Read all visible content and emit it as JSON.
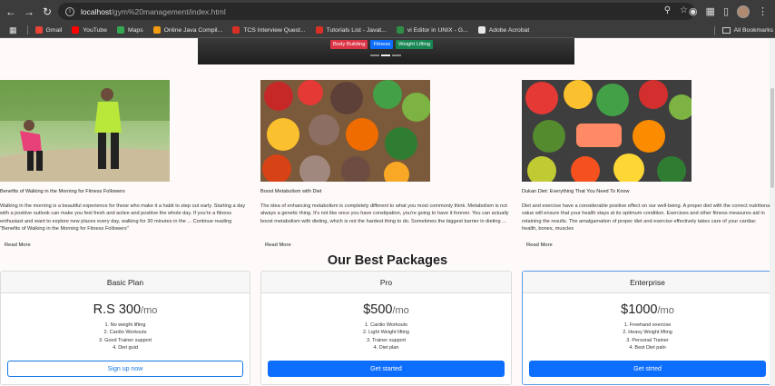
{
  "browser": {
    "url_host": "localhost",
    "url_path": "/gym%20management/index.html",
    "bookmarks": [
      {
        "label": "Gmail",
        "color": "#ea4335"
      },
      {
        "label": "YouTube",
        "color": "#ff0000"
      },
      {
        "label": "Maps",
        "color": "#34a853"
      },
      {
        "label": "Online Java Compil...",
        "color": "#f39c12"
      },
      {
        "label": "TCS Interview Quest...",
        "color": "#d93025"
      },
      {
        "label": "Tutorials List - Javat...",
        "color": "#d93025"
      },
      {
        "label": "vi Editor in UNIX - G...",
        "color": "#2f8d46"
      },
      {
        "label": "Adobe Acrobat",
        "color": "#e8e8e8"
      }
    ],
    "all_bookmarks": "All Bookmarks"
  },
  "hero": {
    "tags": [
      {
        "label": "Body Building",
        "color": "#dc3545"
      },
      {
        "label": "Fitness",
        "color": "#0d6efd"
      },
      {
        "label": "Weight Lifting",
        "color": "#198754"
      }
    ]
  },
  "blog": {
    "posts": [
      {
        "title": "Benefits of Walking in the Morning for Fitness Followers",
        "excerpt": "Walking in the morning is a beautiful experience for those who make it a habit to step out early. Starting a day with a positive outlook can make you feel fresh and active and positive the whole day. If you're a fitness enthusiast and want to explore new places every day, walking for 30 minutes in the ... Continue reading \"Benefits of Walking in the Morning for Fitness Followers\"",
        "read_more": "Read More"
      },
      {
        "title": "Boost Metabolism with Diet",
        "excerpt": "The idea of enhancing metabolism is completely different to what you most commonly think. Metabolism is not always a genetic thing. It's not like once you have constipation, you're going to have it forever. You can actually boost metabolism with dieting, which is not the hardest thing to do. Sometimes the biggest barrier in dieting ...",
        "read_more": "Read More"
      },
      {
        "title": "Dukan Diet: Everything That You Need To Know",
        "excerpt": "Diet and exercise have a considerable positive effect on our well-being. A proper diet with the correct nutritional value will ensure that your health stays at its optimum condition. Exercises and other fitness measures aid in retaining the results. The amalgamation of proper diet and exercise effectively takes care of your cardiac health, bones, muscles",
        "read_more": "Read More"
      }
    ]
  },
  "packages": {
    "title": "Our Best Packages",
    "plans": [
      {
        "name": "Basic Plan",
        "price": "R.S 300",
        "per": "/mo",
        "features": [
          "1. No weight lifting",
          "2. Cardio Workouts",
          "3. Good Trainer support",
          "4. Diet guid"
        ],
        "button": "Sign up now"
      },
      {
        "name": "Pro",
        "price": "$500",
        "per": "/mo",
        "features": [
          "1. Cardio Workouts",
          "2. Light Weight lifting",
          "3. Trainer support",
          "4. Diet plan"
        ],
        "button": "Get started"
      },
      {
        "name": "Enterprise",
        "price": "$1000",
        "per": "/mo",
        "features": [
          "1. Freehand exercise",
          "2. Heavy Weight lifting",
          "3. Personal Trainer",
          "4. Best Diet paln"
        ],
        "button": "Get strted"
      }
    ]
  }
}
